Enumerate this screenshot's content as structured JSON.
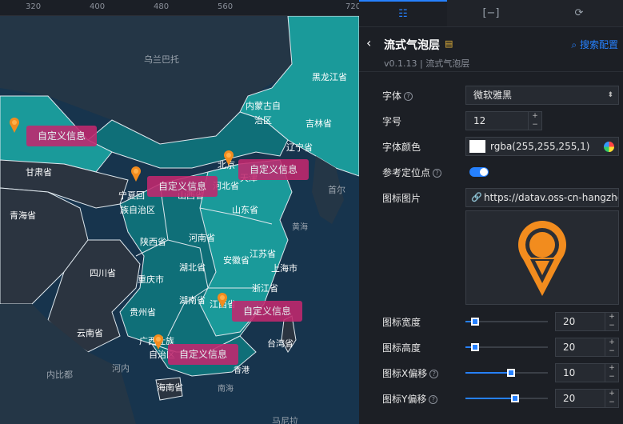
{
  "ruler": {
    "ticks": [
      "320",
      "400",
      "480",
      "560",
      "720"
    ]
  },
  "map": {
    "regions": [
      {
        "name": "乌兰巴托",
        "dim": true
      },
      {
        "name": "黑龙江省",
        "dim": false
      },
      {
        "name": "内蒙古自",
        "dim": false
      },
      {
        "name": "治区",
        "dim": false
      },
      {
        "name": "吉林省",
        "dim": false
      },
      {
        "name": "辽宁省",
        "dim": false
      },
      {
        "name": "甘肃省",
        "dim": false
      },
      {
        "name": "北京",
        "dim": false
      },
      {
        "name": "天津",
        "dim": false
      },
      {
        "name": "河北省",
        "dim": false
      },
      {
        "name": "山西省",
        "dim": false
      },
      {
        "name": "首尔",
        "dim": true
      },
      {
        "name": "宁夏回",
        "dim": false
      },
      {
        "name": "族自治区",
        "dim": false
      },
      {
        "name": "青海省",
        "dim": false
      },
      {
        "name": "山东省",
        "dim": false
      },
      {
        "name": "黄海",
        "dim": true
      },
      {
        "name": "陕西省",
        "dim": false
      },
      {
        "name": "河南省",
        "dim": false
      },
      {
        "name": "四川省",
        "dim": false
      },
      {
        "name": "湖北省",
        "dim": false
      },
      {
        "name": "安徽省",
        "dim": false
      },
      {
        "name": "江苏省",
        "dim": false
      },
      {
        "name": "上海市",
        "dim": false
      },
      {
        "name": "重庆市",
        "dim": false
      },
      {
        "name": "浙江省",
        "dim": false
      },
      {
        "name": "贵州省",
        "dim": false
      },
      {
        "name": "湖南省",
        "dim": false
      },
      {
        "name": "江西省",
        "dim": false
      },
      {
        "name": "云南省",
        "dim": false
      },
      {
        "name": "广西壮族",
        "dim": false
      },
      {
        "name": "自治区",
        "dim": false
      },
      {
        "name": "台湾省",
        "dim": false
      },
      {
        "name": "内比都",
        "dim": true
      },
      {
        "name": "河内",
        "dim": true
      },
      {
        "name": "香港",
        "dim": false
      },
      {
        "name": "海南省",
        "dim": false
      },
      {
        "name": "南海",
        "dim": true
      },
      {
        "name": "马尼拉",
        "dim": true
      }
    ],
    "bubbles": [
      "自定义信息",
      "自定义信息",
      "自定义信息",
      "自定义信息",
      "自定义信息"
    ]
  },
  "panel": {
    "tabs": [
      {
        "name": "settings-sliders-icon",
        "glyph": "☷",
        "active": true
      },
      {
        "name": "bracket-icon",
        "glyph": "[−]",
        "active": false
      },
      {
        "name": "refresh-icon",
        "glyph": "⟳",
        "active": false
      }
    ],
    "back_glyph": "‹",
    "component_name": "流式气泡层",
    "doc_glyph": "▤",
    "version": "v0.1.13 | 流式气泡层",
    "search_config": "搜索配置",
    "search_glyph": "⌕",
    "fields": {
      "font": {
        "label": "字体",
        "value": "微软雅黑"
      },
      "font_size": {
        "label": "字号",
        "value": "12"
      },
      "font_color": {
        "label": "字体颜色",
        "value": "rgba(255,255,255,1)",
        "swatch": "#ffffff"
      },
      "ref_point": {
        "label": "参考定位点",
        "value": true
      },
      "icon_image": {
        "label": "图标图片",
        "value": "https://datav.oss-cn-hangzhou",
        "link_glyph": "🔗"
      },
      "icon_width": {
        "label": "图标宽度",
        "value": "20",
        "slider": 0.12
      },
      "icon_height": {
        "label": "图标高度",
        "value": "20",
        "slider": 0.12
      },
      "icon_x_offset": {
        "label": "图标X偏移",
        "value": "10",
        "slider": 0.55
      },
      "icon_y_offset": {
        "label": "图标Y偏移",
        "value": "20",
        "slider": 0.6
      }
    },
    "help_glyph": "?",
    "spin_up": "+",
    "spin_down": "−",
    "select_arrow": "⬍"
  },
  "colors": {
    "accent": "#2681ff",
    "bubble": "#c2286f",
    "pin": "#f28c1e",
    "teal": "#1a9a9a"
  }
}
